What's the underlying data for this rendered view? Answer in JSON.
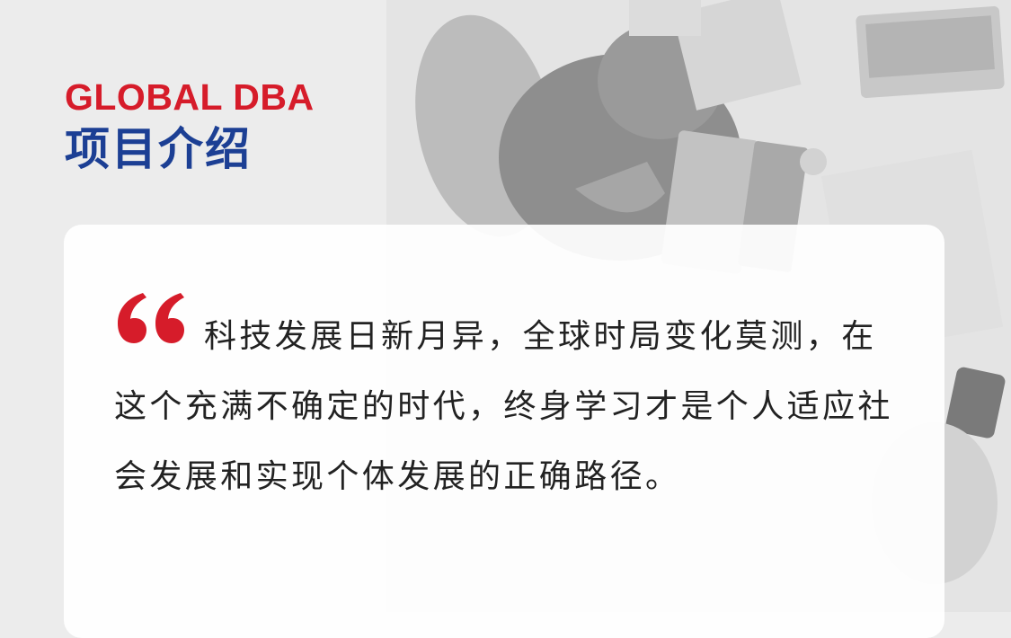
{
  "header": {
    "title_en": "GLOBAL DBA",
    "title_cn": "项目介绍"
  },
  "quote": {
    "text": "科技发展日新月异，全球时局变化莫测，在这个充满不确定的时代，终身学习才是个人适应社会发展和实现个体发展的正确路径。"
  },
  "icons": {
    "quote_mark": "opening-quote-icon"
  },
  "colors": {
    "brand_red": "#d61c2a",
    "brand_blue": "#1c3f94",
    "text": "#222222",
    "background": "#ececec",
    "card": "#ffffff"
  }
}
